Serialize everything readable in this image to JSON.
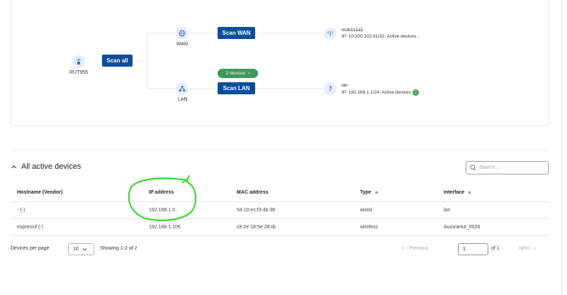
{
  "topology": {
    "router": {
      "label": "RUT955",
      "icon": "router-icon"
    },
    "scan_all_label": "Scan all",
    "wan": {
      "label": "WAN",
      "icon": "globe-icon",
      "scan_label": "Scan WAN"
    },
    "lan": {
      "label": "LAN",
      "icon": "network-icon",
      "scan_label": "Scan LAN",
      "devices_pill": "2 devices"
    },
    "wan_iface": {
      "name": "mob1s1a1",
      "ip_text": "IP: 10.200.102.61/32; Active devices  -"
    },
    "lan_iface": {
      "name": "lan",
      "ip_text": "IP: 192.168.1.1/24; Active devices",
      "active_count": "2"
    }
  },
  "devices": {
    "title": "All active devices",
    "search_placeholder": "Search...",
    "columns": [
      "Hostname (Vendor)",
      "IP address",
      "MAC address",
      "Type",
      "Interface"
    ],
    "rows": [
      [
        "- (-)",
        "192.168.1.5",
        "54:10:ec:f3:4b:38",
        "wired",
        "lan"
      ],
      [
        "espressif (-)",
        "192.168.1.106",
        "c8:2e:18:5e:28:dc",
        "wireless",
        "AuroraHut_0026"
      ]
    ]
  },
  "pagination": {
    "per_page_label": "Devices per page",
    "per_page_value": "10",
    "showing": "Showing 1-2 of 2",
    "previous": "Previous",
    "page_value": "1",
    "of_total": "of 1",
    "next": "Next"
  },
  "colors": {
    "primary": "#0d4d9b",
    "success": "#3c9a57",
    "annotation": "#2fd51d"
  }
}
